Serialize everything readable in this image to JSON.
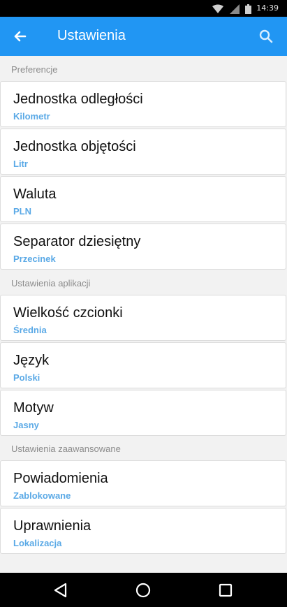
{
  "status_bar": {
    "time": "14:39",
    "icons": [
      "wifi-icon",
      "signal-icon",
      "battery-icon"
    ]
  },
  "app_bar": {
    "title": "Ustawienia",
    "back_icon": "arrow-back-icon",
    "search_icon": "search-icon",
    "color": "#2196f3"
  },
  "sections": [
    {
      "header": "Preferencje",
      "items": [
        {
          "label": "Jednostka odległości",
          "value": "Kilometr"
        },
        {
          "label": "Jednostka objętości",
          "value": "Litr"
        },
        {
          "label": "Waluta",
          "value": "PLN"
        },
        {
          "label": "Separator dziesiętny",
          "value": "Przecinek"
        }
      ]
    },
    {
      "header": "Ustawienia aplikacji",
      "items": [
        {
          "label": "Wielkość czcionki",
          "value": "Średnia"
        },
        {
          "label": "Język",
          "value": "Polski"
        },
        {
          "label": "Motyw",
          "value": "Jasny"
        }
      ]
    },
    {
      "header": "Ustawienia zaawansowane",
      "items": [
        {
          "label": "Powiadomienia",
          "value": "Zablokowane"
        },
        {
          "label": "Uprawnienia",
          "value": "Lokalizacja"
        }
      ]
    }
  ],
  "nav_bar": {
    "icons": [
      "back-triangle-icon",
      "home-circle-icon",
      "recents-square-icon"
    ]
  },
  "colors": {
    "accent": "#2196f3",
    "value_text": "#5aa9e6",
    "background": "#f2f2f2"
  }
}
